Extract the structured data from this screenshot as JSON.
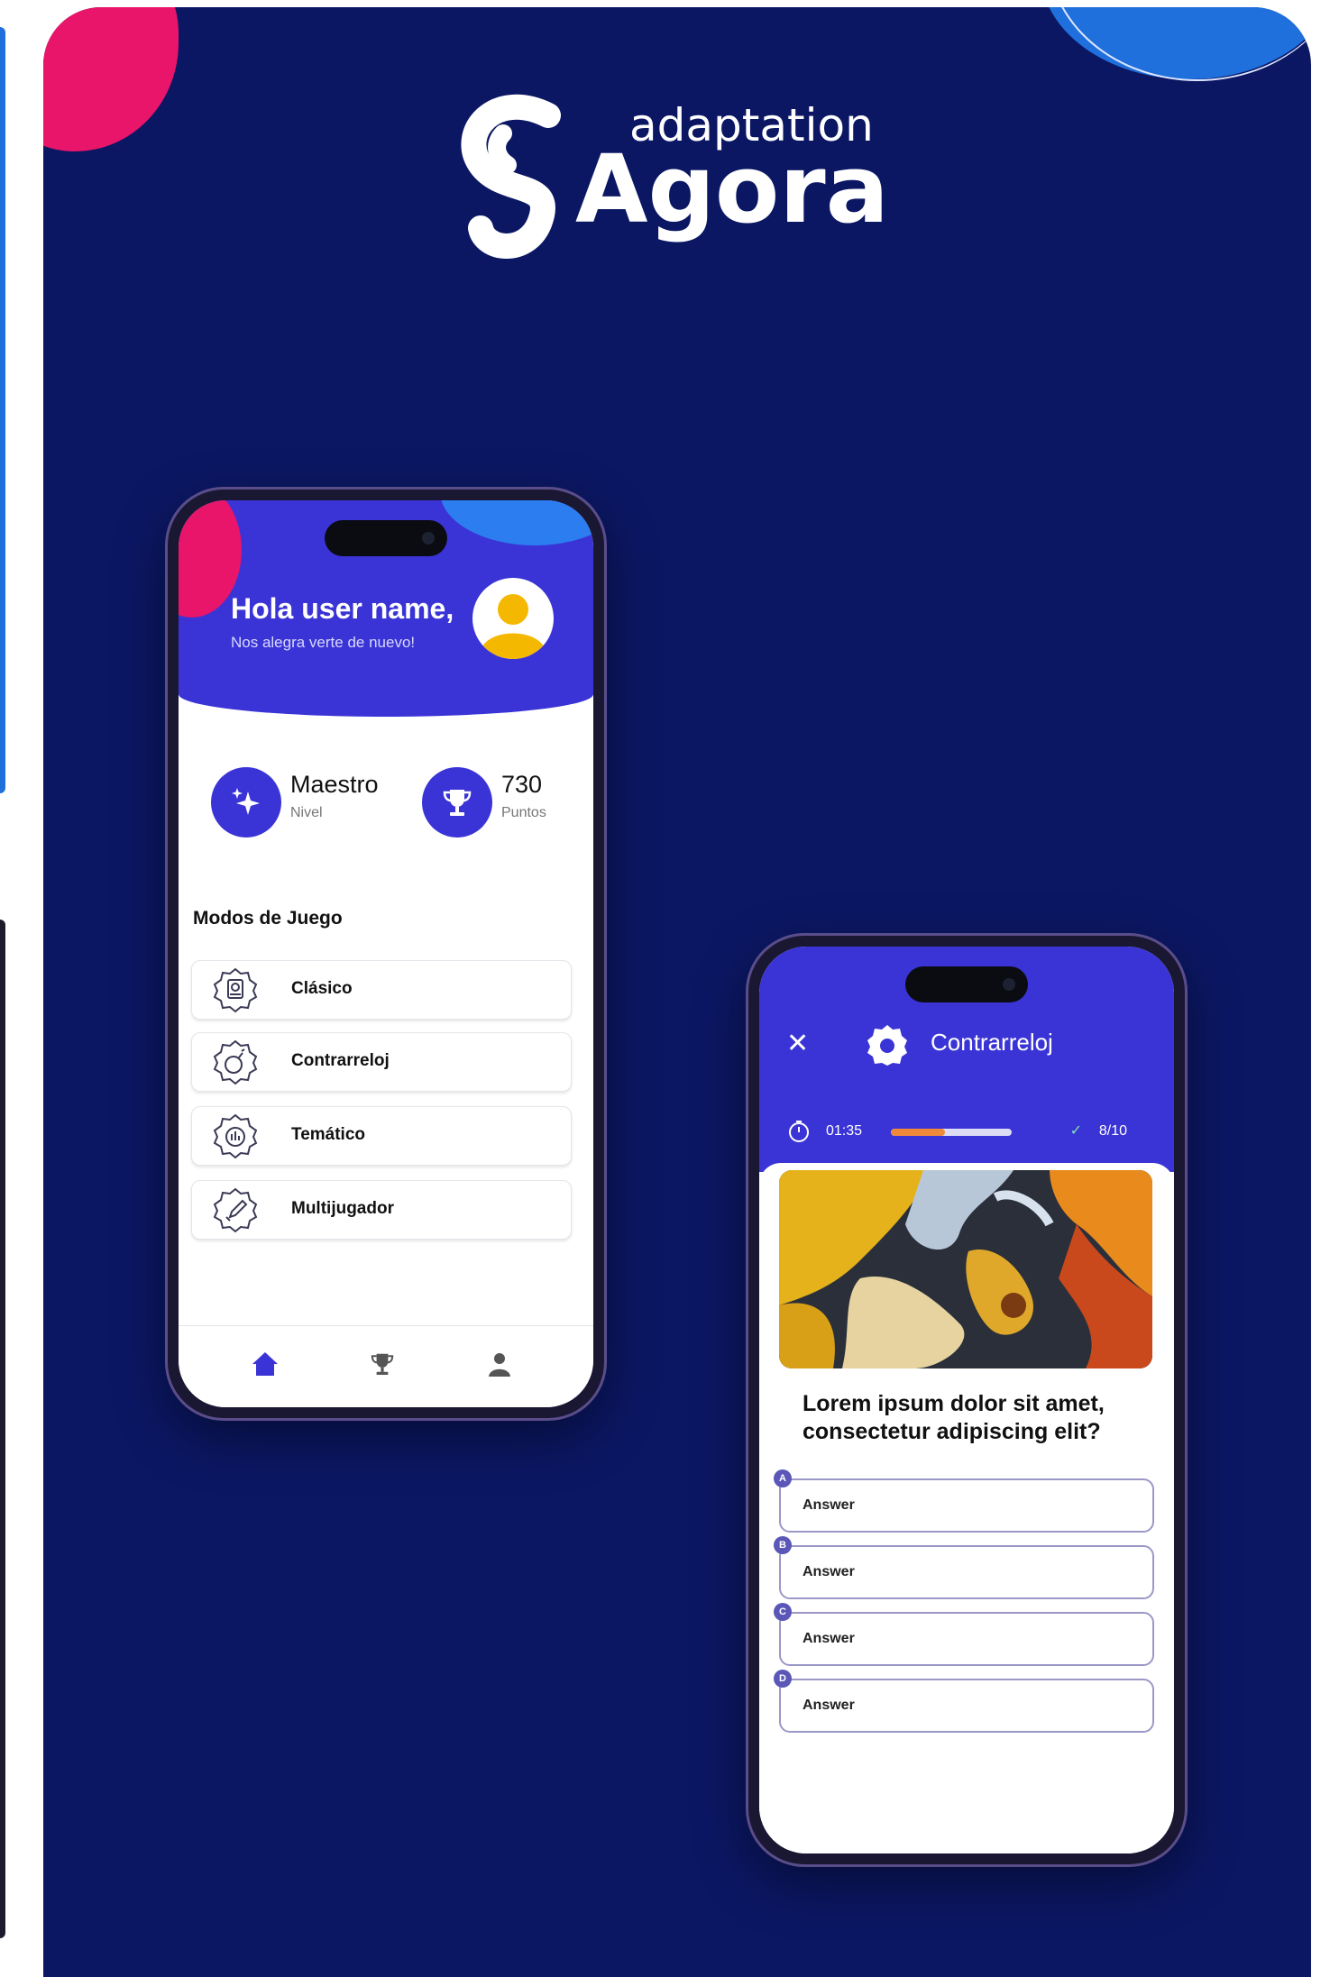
{
  "brand": {
    "logo_top": "adaptation",
    "logo_main": "Agora",
    "colors": {
      "navy": "#0b1763",
      "primary": "#3a34d6",
      "pink": "#e8156a",
      "blue": "#1f6fdc",
      "orange": "#f08a3a"
    }
  },
  "home": {
    "greeting": "Hola user name,",
    "subtitle": "Nos alegra verte de nuevo!",
    "avatar_icon": "user-avatar-icon",
    "stats": [
      {
        "value": "Maestro",
        "label": "Nivel",
        "icon": "sparkles-icon"
      },
      {
        "value": "730",
        "label": "Puntos",
        "icon": "trophy-icon"
      }
    ],
    "section_title": "Modos de Juego",
    "modes": [
      {
        "label": "Clásico",
        "icon": "book-icon"
      },
      {
        "label": "Contrarreloj",
        "icon": "bomb-icon"
      },
      {
        "label": "Temático",
        "icon": "chart-icon"
      },
      {
        "label": "Multijugador",
        "icon": "swords-icon"
      }
    ],
    "tabs": [
      {
        "name": "home",
        "icon": "home-icon",
        "active": true
      },
      {
        "name": "ranking",
        "icon": "trophy-icon",
        "active": false
      },
      {
        "name": "profile",
        "icon": "user-icon",
        "active": false
      }
    ]
  },
  "quiz": {
    "title": "Contrarreloj",
    "close_icon": "close-icon",
    "timer": "01:35",
    "progress": 0.45,
    "score": "8/10",
    "question": "Lorem ipsum dolor sit amet, consectetur adipiscing elit?",
    "answers": [
      {
        "letter": "A",
        "text": "Answer"
      },
      {
        "letter": "B",
        "text": "Answer"
      },
      {
        "letter": "C",
        "text": "Answer"
      },
      {
        "letter": "D",
        "text": "Answer"
      }
    ]
  }
}
